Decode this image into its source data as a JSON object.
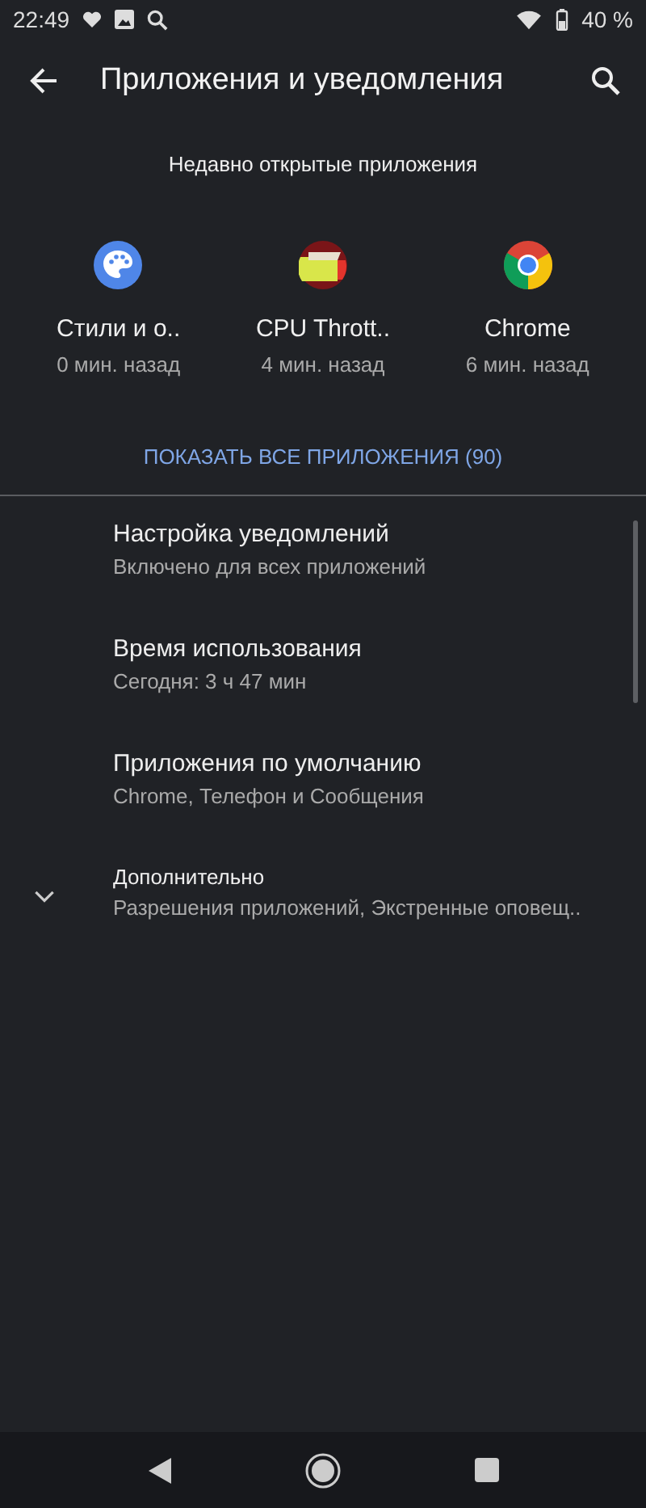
{
  "status_bar": {
    "time": "22:49",
    "battery": "40 %"
  },
  "toolbar": {
    "title": "Приложения и уведомления"
  },
  "recent": {
    "heading": "Недавно открытые приложения",
    "apps": [
      {
        "name": "Стили и о..",
        "time": "0 мин. назад",
        "kind": "palette"
      },
      {
        "name": "CPU Thrott..",
        "time": "4 мин. назад",
        "kind": "cpu"
      },
      {
        "name": "Chrome",
        "time": "6 мин. назад",
        "kind": "chrome"
      }
    ],
    "show_all": "ПОКАЗАТЬ ВСЕ ПРИЛОЖЕНИЯ (90)"
  },
  "settings": [
    {
      "title": "Настройка уведомлений",
      "summary": "Включено для всех приложений",
      "kind": "setting"
    },
    {
      "title": "Время использования",
      "summary": "Сегодня: 3 ч 47 мин",
      "kind": "setting"
    },
    {
      "title": "Приложения по умолчанию",
      "summary": "Chrome, Телефон и Сообщения",
      "kind": "setting"
    },
    {
      "title": "Дополнительно",
      "summary": "Разрешения приложений, Экстренные оповещ..",
      "kind": "advanced"
    }
  ]
}
